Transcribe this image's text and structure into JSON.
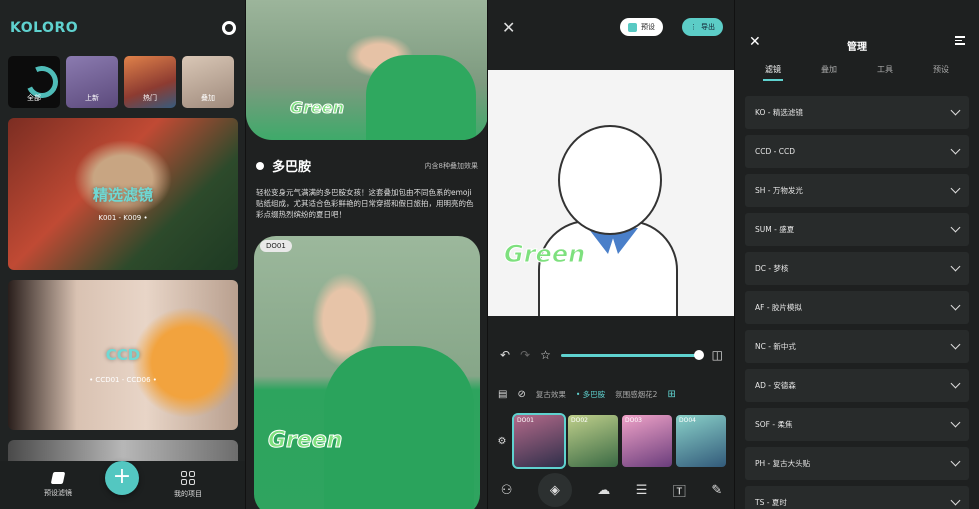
{
  "colors": {
    "accent": "#5fd2cf",
    "background": "#1e2020",
    "card": "#282b2b"
  },
  "panel1": {
    "brand": "KOLORO",
    "categories": [
      {
        "label": "全部"
      },
      {
        "label": "上新"
      },
      {
        "label": "热门"
      },
      {
        "label": "叠加"
      }
    ],
    "card1": {
      "title": "精选滤镜",
      "subtitle": "K001 - K009 •"
    },
    "card2": {
      "title": "CCD",
      "subtitle": "• CCD01 - CCD06 •"
    },
    "nav": {
      "presets": "预设滤镜",
      "add": "+",
      "projects": "我的项目"
    }
  },
  "panel2": {
    "hero_word": "Green",
    "title": "多巴胺",
    "right_note": "内含8种叠加效果",
    "description": "轻松变身元气满满的多巴胺女孩！这套叠加包由不同色系的emoji贴纸组成，尤其适合色彩鲜艳的日常穿搭和假日旅拍，用明亮的色彩点缀热烈缤纷的夏日吧！",
    "preview_tag": "DO01",
    "preview_word": "Green"
  },
  "panel3": {
    "close": "✕",
    "preset_label": "预设",
    "export_label": "导出",
    "canvas_word": "Green",
    "slider_value": 0.98,
    "tabs": [
      "复古效果",
      "• 多巴胺",
      "氛围感烟花2"
    ],
    "thumbs": [
      {
        "label": "DO01"
      },
      {
        "label": "DO02"
      },
      {
        "label": "DO03"
      },
      {
        "label": "DO04"
      }
    ]
  },
  "panel4": {
    "title": "管理",
    "tabs": [
      "滤镜",
      "叠加",
      "工具",
      "预设"
    ],
    "rows": [
      "KO - 精选滤镜",
      "CCD - CCD",
      "SH - 万物发光",
      "SUM - 盛夏",
      "DC - 梦核",
      "AF - 胶片模拟",
      "NC - 新中式",
      "AD - 安德森",
      "SOF - 柔焦",
      "PH - 复古大头贴",
      "TS - 夏时"
    ]
  }
}
